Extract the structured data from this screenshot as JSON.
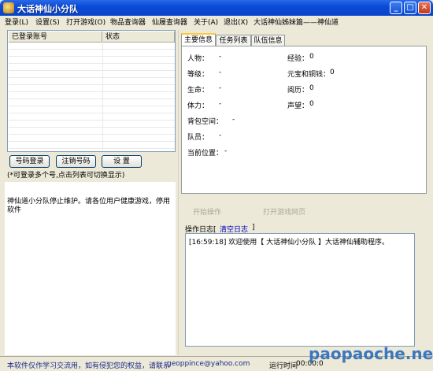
{
  "window": {
    "title": "大话神仙小分队"
  },
  "menu": [
    "登录(L)",
    "设置(S)",
    "打开游戏(O)",
    "物品查询器",
    "仙履查询器",
    "关于(A)",
    "退出(X)",
    "大话神仙姊妹篇——神仙道"
  ],
  "accounts": {
    "col_account": "已登录账号",
    "col_status": "状态"
  },
  "buttons": {
    "code_login": "号码登录",
    "logout": "注销号码",
    "settings": "设 置"
  },
  "hint": "(*可登录多个号,点击列表可切换显示)",
  "notice": "神仙道小分队停止维护。请各位用户健康游戏，停用软件",
  "tabs": [
    "主要信息",
    "任务列表",
    "队伍信息"
  ],
  "info": {
    "person_label": "人物：",
    "person_value": "-",
    "level_label": "等级：",
    "level_value": "-",
    "hp_label": "生命：",
    "hp_value": "-",
    "stamina_label": "体力：",
    "stamina_value": "-",
    "bag_label": "背包空间：",
    "bag_value": "-",
    "team_label": "队员：",
    "team_value": "-",
    "location_label": "当前位置：",
    "location_value": "-",
    "exp_label": "经验：",
    "exp_value": "0",
    "money_label": "元宝和铜钱：",
    "money_value": "0",
    "history_label": "阅历：",
    "history_value": "0",
    "fame_label": "声望：",
    "fame_value": "0"
  },
  "actions": {
    "start": "开始操作",
    "open_web": "打开游戏网页"
  },
  "log": {
    "title": "操作日志[",
    "clear": "清空日志",
    "close_bracket": "]",
    "entry": "[16:59:18] 欢迎使用【 大话神仙小分队 】大话神仙辅助程序。"
  },
  "statusbar": {
    "disclaimer": "本软件仅作学习交流用，如有侵犯您的权益，请联系",
    "email": "geoppince@yahoo.com",
    "runtime_label": "运行时间",
    "runtime_value": "00:00:0"
  },
  "watermark": "paopaoche.net"
}
